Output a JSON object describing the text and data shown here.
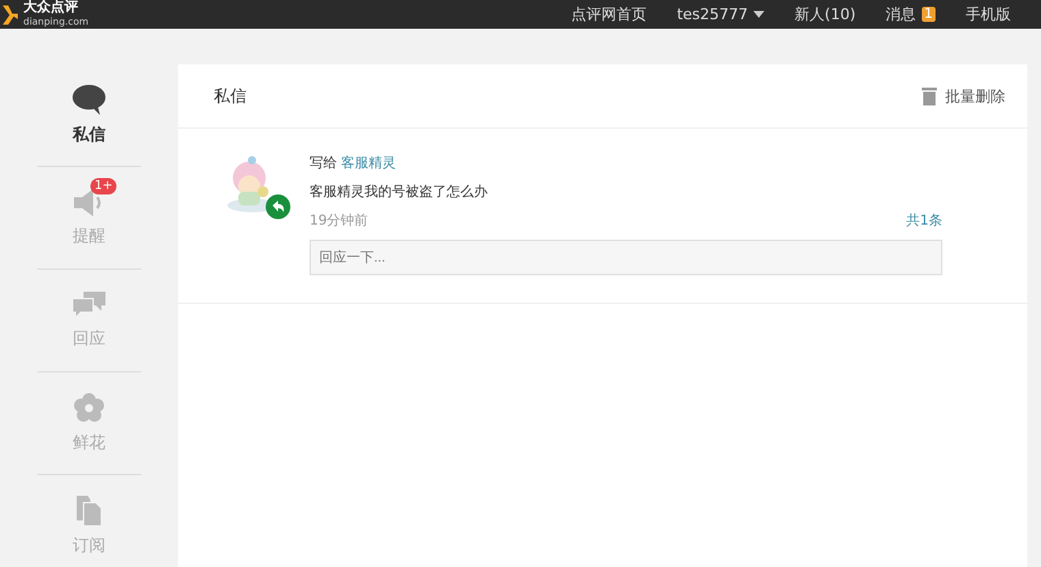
{
  "header": {
    "logo": {
      "name": "大众点评",
      "domain": "dianping.com"
    },
    "nav": [
      {
        "label": "点评网首页"
      },
      {
        "label": "tes25777",
        "dropdown": true
      },
      {
        "label": "新人(10)"
      },
      {
        "label": "消息",
        "badge": "1"
      },
      {
        "label": "手机版"
      }
    ]
  },
  "sidebar": {
    "items": [
      {
        "label": "私信",
        "kind": "chat",
        "selected": true
      },
      {
        "label": "提醒",
        "kind": "alert",
        "selected": false,
        "badge": "1+"
      },
      {
        "label": "回应",
        "kind": "replies",
        "selected": false
      },
      {
        "label": "鲜花",
        "kind": "flower",
        "selected": false
      },
      {
        "label": "订阅",
        "kind": "subscribe",
        "selected": false
      }
    ]
  },
  "panel": {
    "title": "私信",
    "bulk_delete": "批量删除",
    "messages": [
      {
        "prefix": "写给",
        "recipient": "客服精灵",
        "text": "客服精灵我的号被盗了怎么办",
        "time": "19分钟前",
        "count": "共1条",
        "reply_placeholder": "回应一下..."
      }
    ]
  }
}
